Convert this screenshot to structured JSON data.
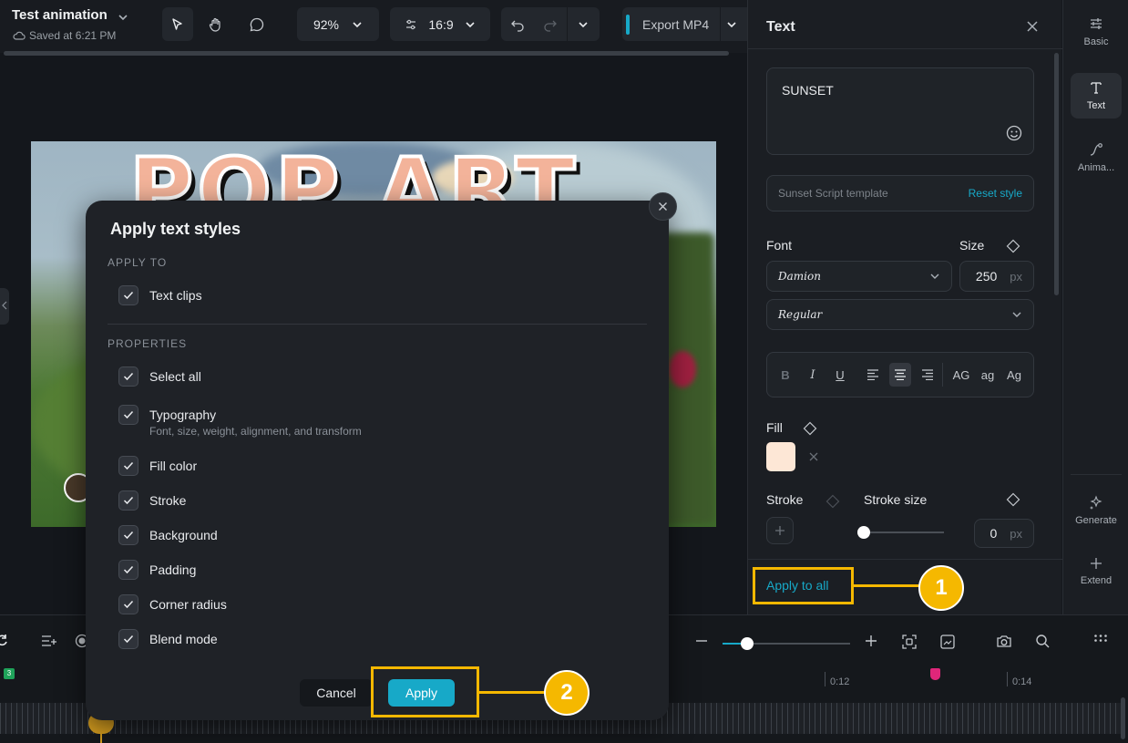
{
  "topbar": {
    "project_title": "Test animation",
    "saved_text": "Saved at 6:21 PM",
    "zoom": "92%",
    "aspect": "16:9",
    "export_label": "Export MP4"
  },
  "preview": {
    "headline": "POP ART"
  },
  "modal": {
    "title": "Apply text styles",
    "apply_to_label": "APPLY TO",
    "apply_to_items": [
      {
        "label": "Text clips",
        "checked": true
      }
    ],
    "properties_label": "PROPERTIES",
    "properties": [
      {
        "label": "Select all",
        "sub": "",
        "checked": true
      },
      {
        "label": "Typography",
        "sub": "Font, size, weight, alignment, and transform",
        "checked": true
      },
      {
        "label": "Fill color",
        "sub": "",
        "checked": true
      },
      {
        "label": "Stroke",
        "sub": "",
        "checked": true
      },
      {
        "label": "Background",
        "sub": "",
        "checked": true
      },
      {
        "label": "Padding",
        "sub": "",
        "checked": true
      },
      {
        "label": "Corner radius",
        "sub": "",
        "checked": true
      },
      {
        "label": "Blend mode",
        "sub": "",
        "checked": true
      }
    ],
    "cancel_label": "Cancel",
    "apply_label": "Apply"
  },
  "panel": {
    "title": "Text",
    "text_value": "SUNSET",
    "template_name": "Sunset Script template",
    "reset_label": "Reset style",
    "font_label": "Font",
    "size_label": "Size",
    "font_family": "Damion",
    "font_weight": "Regular",
    "size_value": "250",
    "size_unit": "px",
    "case_buttons": [
      "AG",
      "ag",
      "Ag"
    ],
    "fill_label": "Fill",
    "fill_color": "#fde7d6",
    "stroke_label": "Stroke",
    "stroke_size_label": "Stroke size",
    "stroke_size_value": "0",
    "stroke_size_unit": "px",
    "apply_all_label": "Apply to all"
  },
  "sidebar": {
    "items": [
      {
        "label": "Basic",
        "icon": "sliders-icon"
      },
      {
        "label": "Text",
        "icon": "text-icon"
      },
      {
        "label": "Anima...",
        "icon": "animation-icon"
      },
      {
        "label": "Generate",
        "icon": "sparkle-icon"
      },
      {
        "label": "Extend",
        "icon": "plus-icon"
      }
    ]
  },
  "timeline": {
    "ticks": [
      "0:12",
      "0:14"
    ],
    "track_badge": "3"
  },
  "annotations": [
    "1",
    "2"
  ],
  "colors": {
    "accent": "#17a9c8",
    "callout": "#f5b800"
  }
}
